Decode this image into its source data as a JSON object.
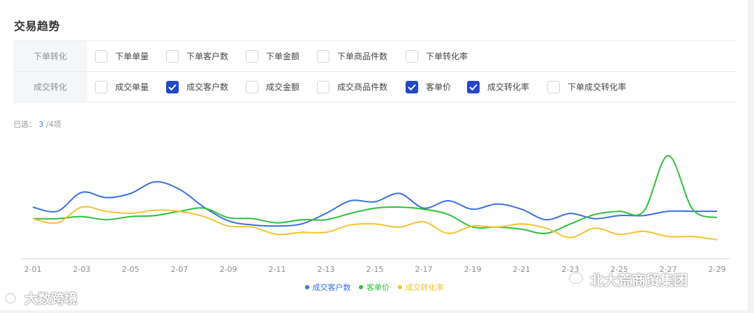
{
  "title": "交易趋势",
  "rows": [
    {
      "label": "下单转化",
      "options": [
        {
          "label": "下单单量",
          "checked": false
        },
        {
          "label": "下单客户数",
          "checked": false
        },
        {
          "label": "下单金额",
          "checked": false
        },
        {
          "label": "下单商品件数",
          "checked": false
        },
        {
          "label": "下单转化率",
          "checked": false
        }
      ]
    },
    {
      "label": "成交转化",
      "options": [
        {
          "label": "成交单量",
          "checked": false
        },
        {
          "label": "成交客户数",
          "checked": true
        },
        {
          "label": "成交金额",
          "checked": false
        },
        {
          "label": "成交商品件数",
          "checked": false
        },
        {
          "label": "客单价",
          "checked": true
        },
        {
          "label": "成交转化率",
          "checked": true
        },
        {
          "label": "下单成交转化率",
          "checked": false
        }
      ]
    }
  ],
  "selection": {
    "prefix": "已选：",
    "count": "3",
    "suffix": "/4项"
  },
  "chart_data": {
    "type": "line",
    "x": [
      "2-01",
      "2-02",
      "2-03",
      "2-04",
      "2-05",
      "2-06",
      "2-07",
      "2-08",
      "2-09",
      "2-10",
      "2-11",
      "2-12",
      "2-13",
      "2-14",
      "2-15",
      "2-16",
      "2-17",
      "2-18",
      "2-19",
      "2-20",
      "2-21",
      "2-22",
      "2-23",
      "2-24",
      "2-25",
      "2-26",
      "2-27",
      "2-28",
      "2-29"
    ],
    "tick_labels": [
      "2-01",
      "2-03",
      "2-05",
      "2-07",
      "2-09",
      "2-11",
      "2-13",
      "2-15",
      "2-17",
      "2-19",
      "2-21",
      "2-23",
      "2-25",
      "2-27",
      "2-29"
    ],
    "series": [
      {
        "name": "成交客户数",
        "color": "#3a6fe0",
        "values": [
          49,
          45,
          63,
          58,
          62,
          73,
          66,
          49,
          36,
          32,
          31,
          33,
          43,
          55,
          54,
          62,
          48,
          55,
          47,
          52,
          47,
          37,
          43,
          38,
          41,
          41,
          45,
          45,
          45
        ]
      },
      {
        "name": "客单价",
        "color": "#2fbf3a",
        "values": [
          38,
          38,
          40,
          37,
          40,
          41,
          45,
          48,
          39,
          38,
          34,
          37,
          37,
          43,
          48,
          49,
          47,
          42,
          30,
          30,
          28,
          24,
          33,
          42,
          45,
          45,
          98,
          47,
          39
        ]
      },
      {
        "name": "成交转化率",
        "color": "#f5c22f",
        "values": [
          38,
          34,
          49,
          45,
          43,
          46,
          45,
          40,
          31,
          30,
          23,
          25,
          25,
          32,
          33,
          30,
          35,
          24,
          31,
          30,
          33,
          29,
          20,
          29,
          23,
          26,
          21,
          21,
          18
        ]
      }
    ],
    "ylim": [
      0,
      120
    ],
    "grid": false,
    "legend": "bottom-center"
  },
  "watermarks": {
    "left": "大数跨境",
    "right": "北大荒商贸集团"
  }
}
